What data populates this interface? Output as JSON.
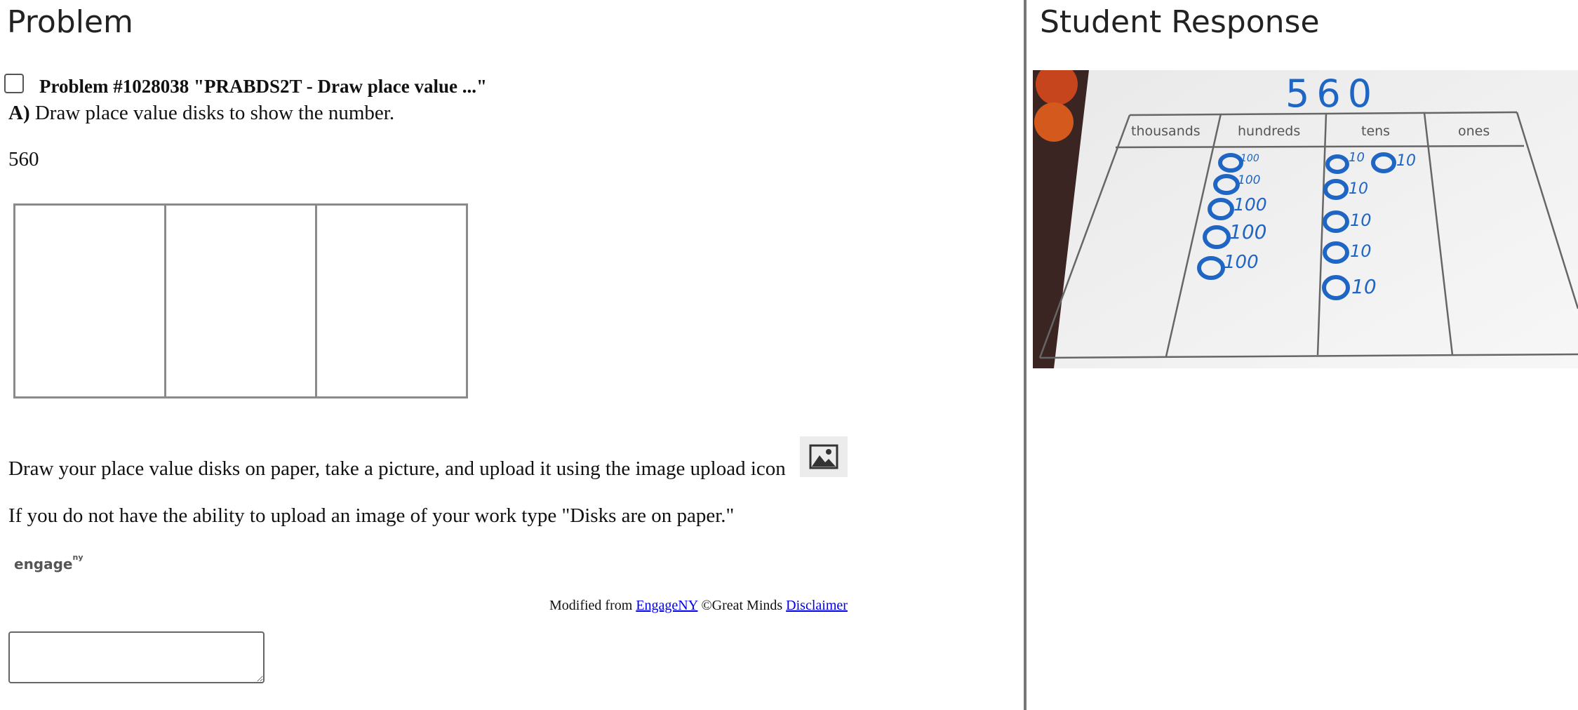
{
  "left_pane": {
    "title": "Problem",
    "problem_name": "Problem #1028038 \"PRABDS2T - Draw place value ...\"",
    "part_label": "A)",
    "prompt": "Draw place value disks to show the number.",
    "number": "560",
    "upload_instruction": "Draw your place value disks on paper, take a picture, and upload it using the image upload icon",
    "alt_instruction": "If you do not have the ability to upload an image of your work type \"Disks are on paper.\"",
    "logo_text": "engage",
    "logo_sup": "ny",
    "credit": {
      "prefix": "Modified from",
      "engage_link": "EngageNY",
      "copyright": "©Great Minds",
      "disclaimer_link": "Disclaimer"
    },
    "answer_value": ""
  },
  "right_pane": {
    "title": "Student Response",
    "photo": {
      "written_number": "560",
      "column_headers": [
        "thousands",
        "hundreds",
        "tens",
        "ones"
      ],
      "hundreds_disks": [
        "100",
        "100",
        "100",
        "100",
        "100"
      ],
      "tens_disks": [
        "10",
        "10",
        "10",
        "10",
        "10",
        "10"
      ]
    }
  },
  "icons": {
    "upload": "image-upload-icon"
  },
  "colors": {
    "link": "#0000ee",
    "divider": "#777777",
    "marker": "#1f66c4"
  }
}
